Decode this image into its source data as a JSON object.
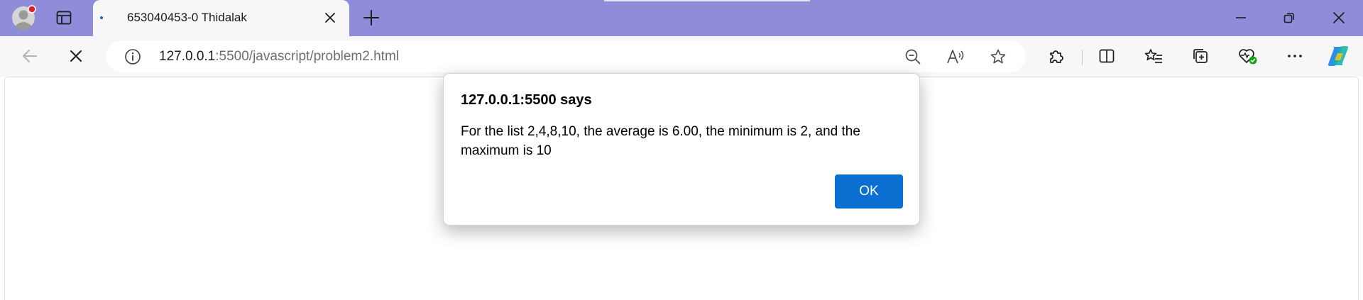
{
  "tab": {
    "title": "653040453-0 Thidalak"
  },
  "address_bar": {
    "url_host": "127.0.0.1",
    "url_rest": ":5500/javascript/problem2.html"
  },
  "dialog": {
    "title": "127.0.0.1:5500 says",
    "message": "For the list 2,4,8,10, the average is 6.00, the minimum is 2, and the maximum is 10",
    "ok_label": "OK"
  },
  "colors": {
    "titlebar": "#8f8cd9",
    "toolbar": "#f7f7f7",
    "ok_button": "#0a6fd0",
    "notification_dot": "#e0232b"
  },
  "icons": {
    "profile": "profile-avatar-icon",
    "tab_actions": "tab-actions-icon",
    "loading": "loading-dot-icon",
    "close_tab": "close-icon",
    "new_tab": "plus-icon",
    "minimize": "minimize-icon",
    "restore": "restore-icon",
    "close_window": "close-icon",
    "back": "back-arrow-icon",
    "stop": "stop-icon",
    "site_info": "info-icon",
    "zoom": "zoom-out-icon",
    "read_aloud": "read-aloud-icon",
    "favorite": "star-icon",
    "extensions": "puzzle-icon",
    "split_screen": "split-screen-icon",
    "favorites": "favorites-list-icon",
    "collections": "collections-icon",
    "browser_essentials": "heart-check-icon",
    "more": "more-icon",
    "copilot": "copilot-icon"
  }
}
